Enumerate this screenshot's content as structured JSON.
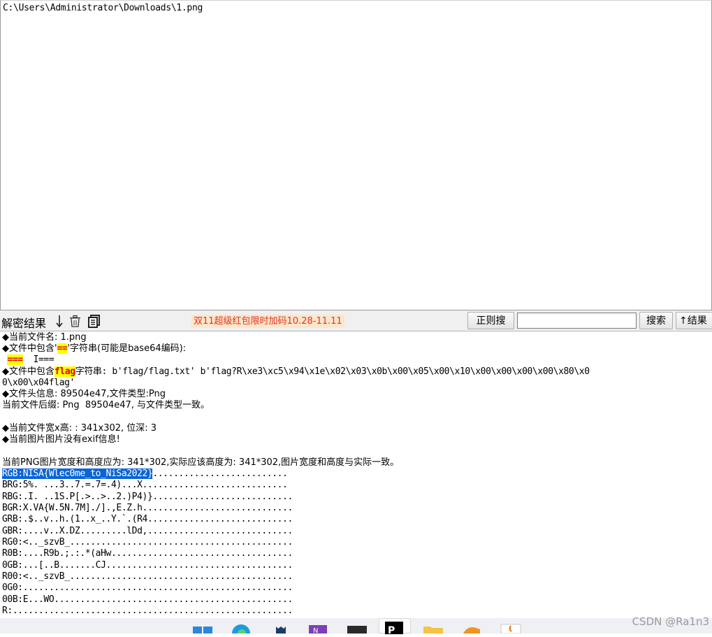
{
  "path_pane": {
    "path": "C:\\Users\\Administrator\\Downloads\\1.png"
  },
  "toolbar": {
    "decrypt_label": "解密结果",
    "promo": "双11超级红包限时加码10.28-11.11",
    "regex_button": "正则搜",
    "search_value": "",
    "search_button": "搜索",
    "results_button": "↑结果"
  },
  "results": {
    "l1": "◆当前文件名: 1.png",
    "l2_pre": "◆文件中包含'",
    "l2_hl": "==",
    "l2_post": "'字符串(可能是base64编码):",
    "l3_hl": "===",
    "l3_post": "  I===",
    "l4_pre": "◆文件中包含",
    "l4_hl": "flag",
    "l4_post": "字符串: b'flag/flag.txt' b'flag?R\\xe3\\xc5\\x94\\x1e\\x02\\x03\\x0b\\x00\\x05\\x00\\x10\\x00\\x00\\x00\\x00\\x80\\x0",
    "l5": "0\\x00\\x04flag'",
    "l6": "◆文件头信息: 89504e47,文件类型:Png",
    "l7": "当前文件后缀: Png  89504e47, 与文件类型一致。",
    "l8": "◆当前文件宽x高: : 341x302, 位深: 3",
    "l9": "◆当前图片图片没有exif信息!",
    "l10": "当前PNG图片宽度和高度应为: 341*302,实际应该高度为: 341*302,图片宽度和高度与实际一致。",
    "rgb_sel": "RGB:NISA{Wlec0me_to_NiSa2022}",
    "rgb_rest": "..........................",
    "rows": [
      "BRG:5%. ...3..7.=.7=.4)...X............................",
      "RBG:.I. ..1S.P[.>..>..2.)P4)}...........................",
      "BGR:X.VA{W.5N.7M]./].,E.Z.h.............................",
      "GRB:.$..v..h.(1..x_..Y.`.(R4............................",
      "GBR:....v..X.DZ.........lDd,............................",
      "RG0:<.._szvB_...........................................",
      "R0B:....R9b.;.:.*(aHw...................................",
      "0GB:...[..B.......CJ....................................",
      "R00:<.._szvB_...........................................",
      "0G0:....................................................",
      "00B:E...WO..............................................",
      "R:......................................................"
    ]
  },
  "watermark": "CSDN @Ra1n3",
  "colors": {
    "selection": "#0a64d6",
    "highlight": "#ffff00",
    "promo_text": "#e3341c"
  }
}
